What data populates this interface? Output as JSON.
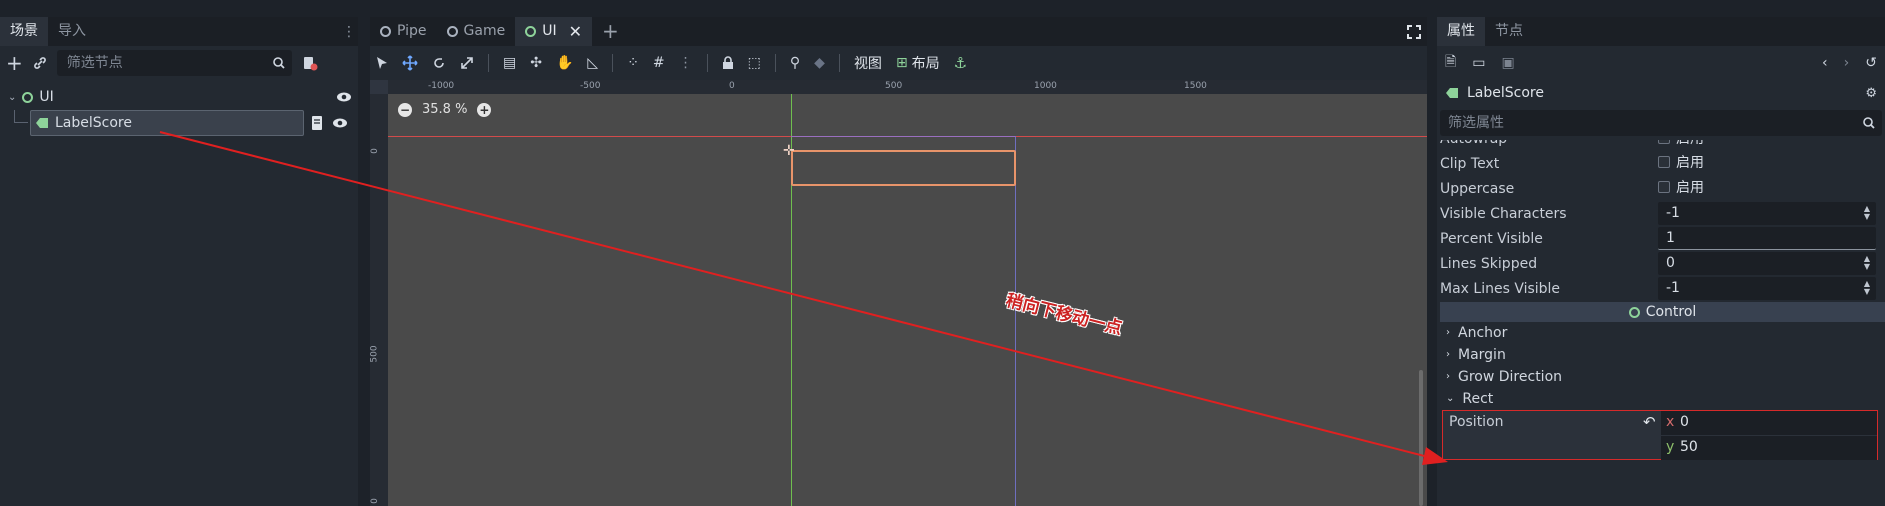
{
  "left_dock": {
    "tabs": [
      "场景",
      "导入"
    ],
    "filter_placeholder": "筛选节点",
    "tree": {
      "root": "UI",
      "child": "LabelScore"
    }
  },
  "center": {
    "scene_tabs": [
      "Pipe",
      "Game",
      "UI"
    ],
    "toolbar": {
      "view": "视图",
      "layout": "布局"
    },
    "ruler_labels": [
      "-1000",
      "-500",
      "0",
      "500",
      "1000",
      "1500"
    ],
    "ruler_left_labels": [
      "0",
      "500",
      "0"
    ],
    "zoom": "35.8 %"
  },
  "inspector": {
    "tabs": [
      "属性",
      "节点"
    ],
    "object_name": "LabelScore",
    "filter_placeholder": "筛选属性",
    "cut_prop": {
      "name": "Autowrap",
      "value": "启用"
    },
    "props": [
      {
        "name": "Clip Text",
        "value": "启用"
      },
      {
        "name": "Uppercase",
        "value": "启用"
      },
      {
        "name": "Visible Characters",
        "value": "-1"
      },
      {
        "name": "Percent Visible",
        "value": "1"
      },
      {
        "name": "Lines Skipped",
        "value": "0"
      },
      {
        "name": "Max Lines Visible",
        "value": "-1"
      }
    ],
    "control_header": "Control",
    "sections": [
      "Anchor",
      "Margin",
      "Grow Direction",
      "Rect"
    ],
    "position": {
      "label": "Position",
      "x_label": "x",
      "x": "0",
      "y_label": "y",
      "y": "50"
    }
  },
  "annotation": {
    "text": "稍向下移动一点",
    "color": "#dd2222"
  },
  "colors": {
    "selection_orange": "#e8946a",
    "accent_green": "#8ed39a",
    "background": "#1d2229"
  }
}
